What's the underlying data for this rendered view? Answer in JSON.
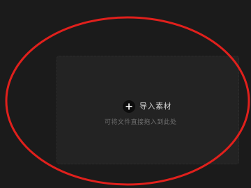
{
  "dropzone": {
    "import_label": "导入素材",
    "hint": "可将文件直接拖入到此处",
    "icon": "plus-circle-icon"
  },
  "annotation": {
    "shape": "ellipse",
    "color": "#e0201c"
  },
  "colors": {
    "background": "#1b1b1b",
    "dropzone_bg": "#232323",
    "label": "#d4d4d4",
    "hint": "#6f6f6f"
  }
}
